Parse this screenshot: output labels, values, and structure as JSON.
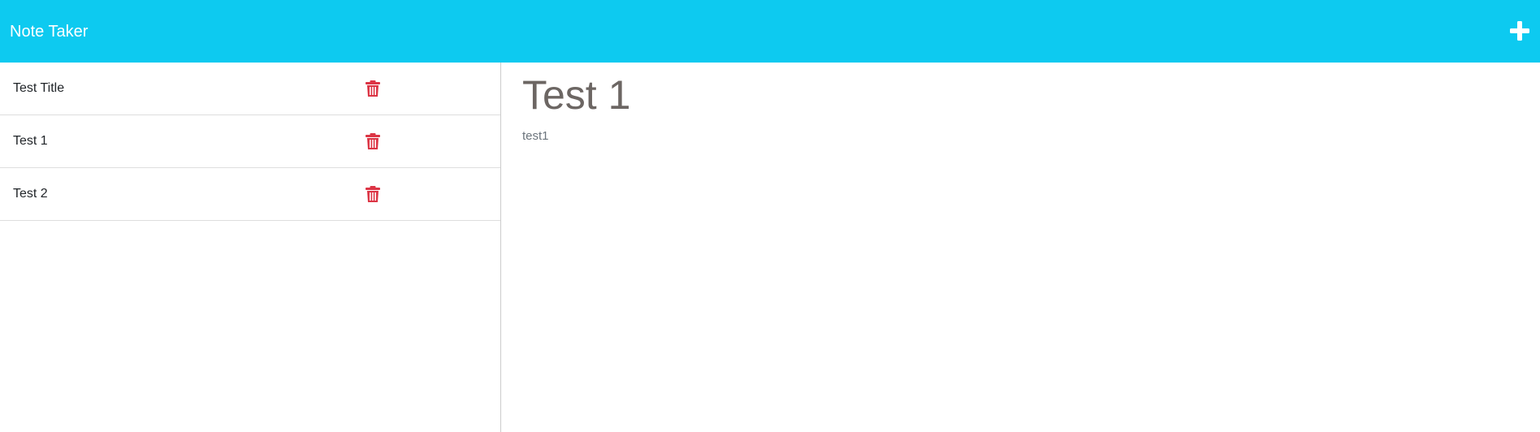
{
  "app": {
    "title": "Note Taker"
  },
  "colors": {
    "navbar": "#0dcaf0",
    "delete_icon": "#dc3545",
    "note_title": "#6c6663"
  },
  "icons": {
    "new_note": "plus-icon",
    "delete": "trash-icon"
  },
  "notes": [
    {
      "title": "Test Title"
    },
    {
      "title": "Test 1"
    },
    {
      "title": "Test 2"
    }
  ],
  "active_note": {
    "title": "Test 1",
    "text": "test1"
  }
}
